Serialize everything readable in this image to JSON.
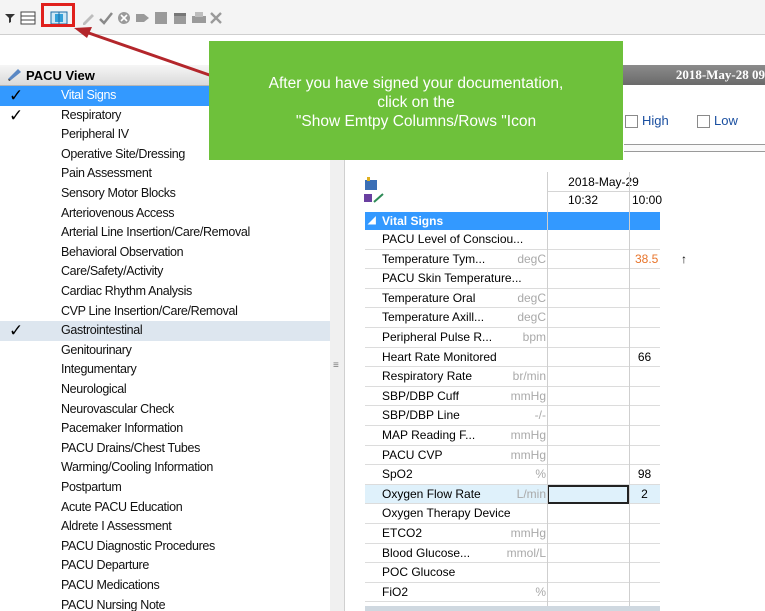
{
  "toolbar": {
    "icons": [
      "filter-icon",
      "grid-icon",
      "show-empty-columns-icon",
      "sign-pen-icon",
      "checkmark-icon",
      "clear-icon",
      "tag-icon",
      "table-icon",
      "calendar-icon",
      "print-icon",
      "close-x-icon"
    ]
  },
  "nav": {
    "header": "PACU View",
    "items": [
      {
        "label": "Vital Signs",
        "checked": true,
        "selected": true
      },
      {
        "label": "Respiratory",
        "checked": true
      },
      {
        "label": "Peripheral IV"
      },
      {
        "label": "Operative Site/Dressing"
      },
      {
        "label": "Pain Assessment"
      },
      {
        "label": "Sensory Motor Blocks"
      },
      {
        "label": "Arteriovenous Access"
      },
      {
        "label": "Arterial Line Insertion/Care/Removal"
      },
      {
        "label": "Behavioral Observation"
      },
      {
        "label": "Care/Safety/Activity"
      },
      {
        "label": "Cardiac Rhythm Analysis"
      },
      {
        "label": "CVP Line Insertion/Care/Removal"
      },
      {
        "label": "Gastrointestinal",
        "checked": true,
        "alt": true
      },
      {
        "label": "Genitourinary"
      },
      {
        "label": "Integumentary"
      },
      {
        "label": "Neurological"
      },
      {
        "label": "Neurovascular Check"
      },
      {
        "label": "Pacemaker Information"
      },
      {
        "label": "PACU Drains/Chest Tubes"
      },
      {
        "label": "Warming/Cooling Information"
      },
      {
        "label": "Postpartum"
      },
      {
        "label": "Acute PACU Education"
      },
      {
        "label": "Aldrete I Assessment"
      },
      {
        "label": "PACU Diagnostic Procedures"
      },
      {
        "label": "PACU Departure"
      },
      {
        "label": "PACU Medications"
      },
      {
        "label": "PACU Nursing Note"
      }
    ]
  },
  "header": {
    "date": "2018-May-28 09"
  },
  "filters": {
    "high_label": "High",
    "low_label": "Low"
  },
  "grid": {
    "date": "2018-May-29",
    "times": [
      "10:32",
      "10:00"
    ],
    "section": "Vital Signs",
    "rows": [
      {
        "label": "PACU Level of Consciou...",
        "unit": "",
        "value": ""
      },
      {
        "label": "Temperature Tym...",
        "unit": "degC",
        "value": "38.5",
        "hot": true,
        "arrow": "↑"
      },
      {
        "label": "PACU Skin Temperature...",
        "unit": "",
        "value": ""
      },
      {
        "label": "Temperature Oral",
        "unit": "degC",
        "value": ""
      },
      {
        "label": "Temperature Axill...",
        "unit": "degC",
        "value": ""
      },
      {
        "label": "Peripheral Pulse R...",
        "unit": "bpm",
        "value": ""
      },
      {
        "label": "Heart Rate Monitored",
        "unit": "",
        "value": "66"
      },
      {
        "label": "Respiratory Rate",
        "unit": "br/min",
        "value": ""
      },
      {
        "label": "SBP/DBP Cuff",
        "unit": "mmHg",
        "value": ""
      },
      {
        "label": "SBP/DBP Line",
        "unit": "-/-",
        "value": ""
      },
      {
        "label": "MAP Reading F...",
        "unit": "mmHg",
        "value": ""
      },
      {
        "label": "PACU CVP",
        "unit": "mmHg",
        "value": ""
      },
      {
        "label": "SpO2",
        "unit": "%",
        "value": "98"
      },
      {
        "label": "Oxygen Flow Rate",
        "unit": "L/min",
        "value": "2",
        "highlight": true
      },
      {
        "label": "Oxygen Therapy Device",
        "unit": "",
        "value": ""
      },
      {
        "label": "ETCO2",
        "unit": "mmHg",
        "value": ""
      },
      {
        "label": "Blood Glucose...",
        "unit": "mmol/L",
        "value": ""
      },
      {
        "label": "POC Glucose",
        "unit": "",
        "value": ""
      },
      {
        "label": "FiO2",
        "unit": "%",
        "value": ""
      }
    ]
  },
  "callout": {
    "line1": "After you  have signed your documentation,",
    "line2": "click on the",
    "line3": "\"Show Emtpy Columns/Rows \"Icon"
  },
  "colors": {
    "selection": "#3399ff",
    "callout": "#6ec13b",
    "highlight_box": "#e0201c",
    "abnormal": "#e8742a"
  }
}
